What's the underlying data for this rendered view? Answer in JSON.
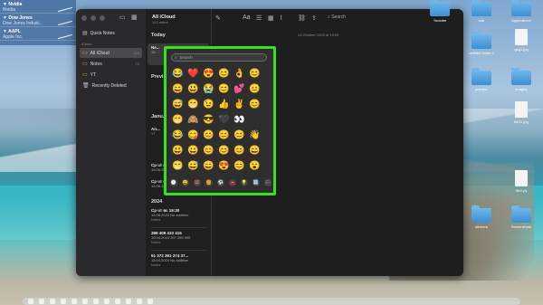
{
  "widget": {
    "rows": [
      {
        "sym": "▼ Nvidia",
        "sub": "Nvidia"
      },
      {
        "sym": "▼ Dow Jones",
        "sub": "Dow Jones Indust..."
      },
      {
        "sym": "▼ AAPL",
        "sub": "Apple Inc."
      }
    ]
  },
  "sidebar": {
    "quick_notes": "Quick Notes",
    "section": "iCloud",
    "items": [
      {
        "label": "All iCloud",
        "count": "142"
      },
      {
        "label": "Notes",
        "count": "73"
      },
      {
        "label": "YT",
        "count": ""
      },
      {
        "label": "Recently Deleted",
        "count": ""
      }
    ]
  },
  "notelist": {
    "title": "All iCloud",
    "subtitle": "142 notes",
    "groups": {
      "today": "Today",
      "previous": "Previ...",
      "january": "Janu...",
      "year": "2024"
    },
    "notes": [
      {
        "title": "Ne...",
        "meta": "15:...",
        "folder": ""
      },
      {
        "title": "Ап...",
        "meta": "",
        "folder": "YT"
      },
      {
        "title": "Ср чт вс 15:30",
        "meta": "15.08.2024  No addition",
        "folder": "Notes"
      },
      {
        "title": "399 409 410 415",
        "meta": "15.04.2024  397 395 395",
        "folder": "Notes"
      },
      {
        "title": "51 372 361 374 37...",
        "meta": "15.04.2024  No addition",
        "folder": "Notes"
      }
    ],
    "sample_notes": [
      {
        "title": "Ср чт вс 15:30",
        "meta": "15.06.2024  No additio"
      },
      {
        "title": "Ср чт вс 15:30",
        "meta": "15.06.2024  No additio"
      }
    ]
  },
  "editor": {
    "search_label": "Search",
    "date": "14 October 2025 at 19:59",
    "toolbar_icons": [
      "compose-icon",
      "text-format-icon",
      "checklist-icon",
      "table-icon",
      "attachment-icon",
      "link-icon",
      "search-icon"
    ]
  },
  "picker": {
    "search_placeholder": "Search",
    "emojis": [
      "😂",
      "❤️",
      "😍",
      "😊",
      "👌",
      "😊",
      "😄",
      "😃",
      "😭",
      "😊",
      "💕",
      "😐",
      "😅",
      "😁",
      "😉",
      "👍",
      "✌️",
      "😊",
      "😁",
      "🙈",
      "😎",
      "🖤",
      "👀",
      "",
      "😂",
      "😋",
      "😊",
      "😊",
      "😊",
      "👋",
      "😃",
      "😀",
      "😊",
      "😊",
      "😊",
      "😄",
      "😁",
      "😅",
      "😄",
      "😍",
      "😊",
      "😮"
    ],
    "categories": [
      "🕒",
      "😀",
      "🐻",
      "🍔",
      "⚽",
      "🚗",
      "💡",
      "🔣",
      "🏳"
    ]
  },
  "desktop": {
    "icons": [
      {
        "label": "Youtube"
      },
      {
        "label": "ball"
      },
      {
        "label": "Applications"
      },
      {
        "label": "untitled folder 2"
      },
      {
        "label": "gag1.jpg"
      },
      {
        "label": "preview"
      },
      {
        "label": "images"
      },
      {
        "label": "file11.jpg"
      },
      {
        "label": "file2.py"
      },
      {
        "label": "stickers"
      },
      {
        "label": "Screenshots"
      }
    ]
  }
}
